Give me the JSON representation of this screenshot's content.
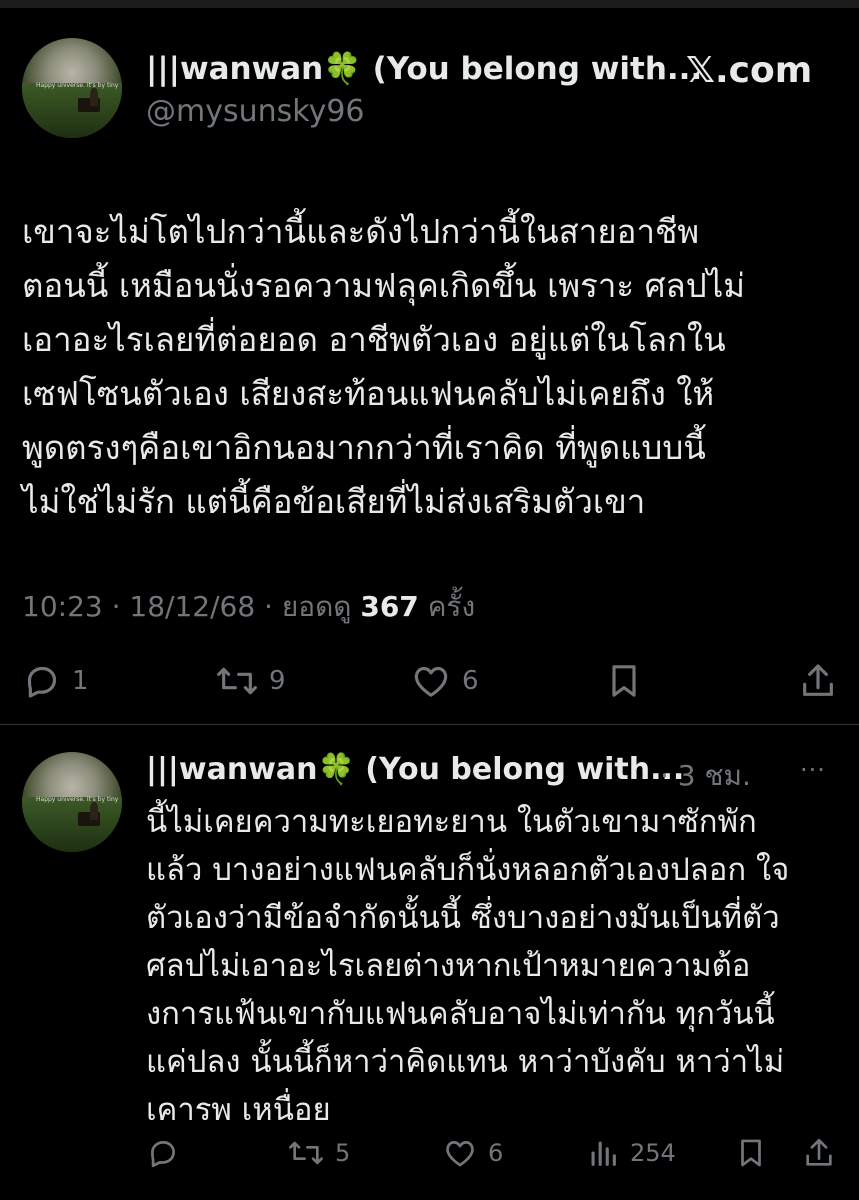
{
  "tweet1": {
    "display_name": "|||wanwan🍀 (You belong with...",
    "handle": "@mysunsky96",
    "brand": "𝕏.com",
    "avatar_caption": "Happy universe. It's by tiny",
    "text_lines": [
      "เขาจะไม่โตไปกว่านี้และดังไปกว่านี้ในสายอาชีพ",
      "ตอนนี้ เหมือนนั่งรอความฟลุคเกิดขึ้น เพราะ ศลปไม่",
      "เอาอะไรเลยที่ต่อยอด อาชีพตัวเอง อยู่แต่ในโลกใน",
      "เซฟโซนตัวเอง เสียงสะท้อนแฟนคลับไม่เคยถึง ให้",
      "พูดตรงๆคือเขาอิกนอมากกว่าที่เราคิด ที่พูดแบบนี้",
      "ไม่ใช่ไม่รัก  แต่นี้คือข้อเสียที่ไม่ส่งเสริมตัวเขา"
    ],
    "meta_time": "10:23 · 18/12/68 · ยอดดู ",
    "meta_views": "367",
    "meta_suffix": " ครั้ง",
    "replies": "1",
    "reposts": "9",
    "likes": "6"
  },
  "tweet2": {
    "display_name": "|||wanwan🍀 (You belong with...",
    "time": "· 3 ชม.",
    "more": "···",
    "text_lines": [
      "นี้ไม่เคยความทะเยอทะยาน ในตัวเขามาซักพัก",
      "แล้ว บางอย่างแฟนคลับก็นั่งหลอกตัวเองปลอก ใจ",
      "ตัวเองว่ามีข้อจำกัดนั้นนี้ ซึ่งบางอย่างมันเป็นที่ตัว",
      "ศลปไม่เอาอะไรเลยต่างหากเป้าหมายความต้อ",
      "งการแฟ้นเขากับแฟนคลับอาจไม่เท่ากัน ทุกวันนี้",
      "แค่ปลง นั้นนี้ก็หาว่าคิดแทน หาว่าบังคับ หาว่าไม่",
      "เคารพ เหนื่อย"
    ],
    "reposts": "5",
    "likes": "6",
    "views": "254"
  },
  "icons": [
    "reply-icon",
    "repost-icon",
    "like-icon",
    "bookmark-icon",
    "share-icon",
    "views-icon",
    "more-icon"
  ]
}
